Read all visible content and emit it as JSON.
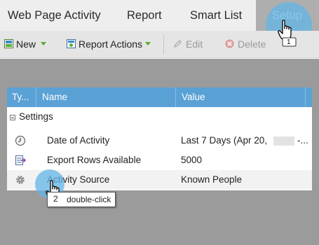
{
  "tabs": [
    {
      "label": "Web Page Activity"
    },
    {
      "label": "Report"
    },
    {
      "label": "Smart List"
    },
    {
      "label": "Setup"
    }
  ],
  "toolbar": {
    "new_label": "New",
    "report_actions_label": "Report Actions",
    "edit_label": "Edit",
    "delete_label": "Delete"
  },
  "grid": {
    "columns": [
      "Ty...",
      "Name",
      "Value"
    ],
    "group_label": "Settings",
    "rows": [
      {
        "icon": "clock-icon",
        "name": "Date of Activity",
        "value": "Last 7 Days (Apr 20,",
        "value_suffix": "-..."
      },
      {
        "icon": "export-rows-icon",
        "name": "Export Rows Available",
        "value": "5000"
      },
      {
        "icon": "gear-icon",
        "name": "Activity Source",
        "value": "Known People"
      }
    ]
  },
  "annotations": {
    "step1_number": "1",
    "step2_number": "2",
    "step2_text": "double-click"
  },
  "colors": {
    "header_blue": "#5aa1d6",
    "highlight_blue": "#62b5e5",
    "active_tab": "#aeaeae",
    "dropdown_green": "#5aaa2c"
  }
}
